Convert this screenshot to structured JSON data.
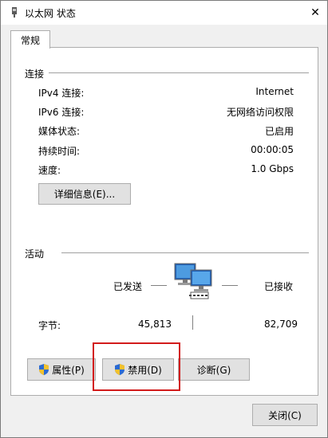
{
  "window": {
    "title": "以太网 状态",
    "close_glyph": "✕"
  },
  "tabs": [
    {
      "label": "常规"
    }
  ],
  "connection": {
    "heading": "连接",
    "rows": [
      {
        "label": "IPv4 连接:",
        "value": "Internet"
      },
      {
        "label": "IPv6 连接:",
        "value": "无网络访问权限"
      },
      {
        "label": "媒体状态:",
        "value": "已启用"
      },
      {
        "label": "持续时间:",
        "value": "00:00:05"
      },
      {
        "label": "速度:",
        "value": "1.0 Gbps"
      }
    ],
    "details_button": "详细信息(E)..."
  },
  "activity": {
    "heading": "活动",
    "sent_label": "已发送",
    "received_label": "已接收",
    "bytes_label": "字节:",
    "bytes_sent": "45,813",
    "bytes_received": "82,709"
  },
  "buttons": {
    "properties": "属性(P)",
    "disable": "禁用(D)",
    "diagnose": "诊断(G)",
    "close": "关闭(C)"
  },
  "colors": {
    "highlight_box": "#d21b1b",
    "shield_blue": "#2a6ad3",
    "shield_yellow": "#f2c12e"
  }
}
